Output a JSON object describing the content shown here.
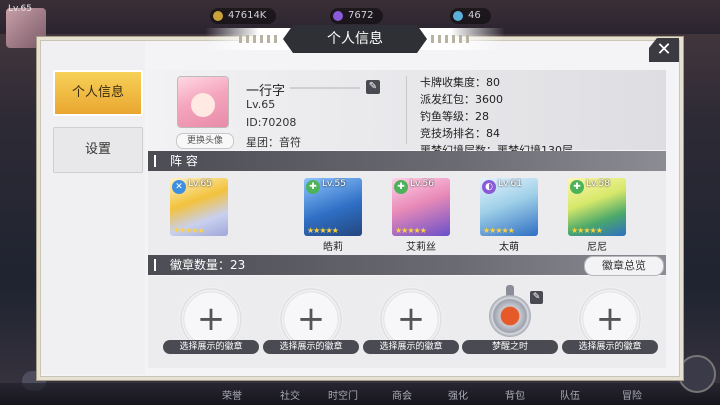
{
  "background": {
    "player_level": "Lv.65",
    "resources": [
      "47614K",
      "7672",
      "46"
    ],
    "bottom_nav": [
      "荣誉",
      "社交",
      "时空门",
      "商会",
      "强化",
      "背包",
      "队伍",
      "冒险"
    ]
  },
  "dialog": {
    "title": "个人信息",
    "close_label": "✕"
  },
  "sidebar": {
    "tabs": [
      {
        "label": "个人信息",
        "active": true
      },
      {
        "label": "设置",
        "active": false
      }
    ]
  },
  "profile": {
    "name": "一行字",
    "level": "Lv.65",
    "id": "ID:70208",
    "guild": "星团：音符",
    "change_avatar": "更换头像",
    "stats": [
      "卡牌收集度：80",
      "派发红包：3600",
      "钓鱼等级：28",
      "竞技场排名：84",
      "噩梦幻境层数：噩梦幻境130层"
    ]
  },
  "lineup": {
    "title": "阵 容",
    "units": [
      {
        "level": "Lv.65",
        "name": "",
        "stars": "★★★★★",
        "color": "#f2c23c",
        "class_color": "#3f8fe0"
      },
      {
        "level": "Lv.55",
        "name": "皓莉",
        "stars": "★★★★★",
        "color": "#2f6fc4",
        "class_color": "#4db35a"
      },
      {
        "level": "Lv.56",
        "name": "艾莉丝",
        "stars": "★★★★★",
        "color": "#6a4fc8",
        "class_color": "#4db35a"
      },
      {
        "level": "Lv.61",
        "name": "太萌",
        "stars": "★★★★★",
        "color": "#2f6fc4",
        "class_color": "#8a5ad8"
      },
      {
        "level": "Lv.58",
        "name": "尼尼",
        "stars": "★★★★★",
        "color": "#2f6fc4",
        "class_color": "#4db35a"
      }
    ]
  },
  "badges": {
    "title": "徽章数量：23",
    "overview_button": "徽章总览",
    "slots": [
      {
        "label": "选择展示的徽章",
        "filled": false
      },
      {
        "label": "选择展示的徽章",
        "filled": false
      },
      {
        "label": "选择展示的徽章",
        "filled": false
      },
      {
        "label": "梦醒之时",
        "filled": true
      },
      {
        "label": "选择展示的徽章",
        "filled": false
      }
    ],
    "plus": "+"
  }
}
